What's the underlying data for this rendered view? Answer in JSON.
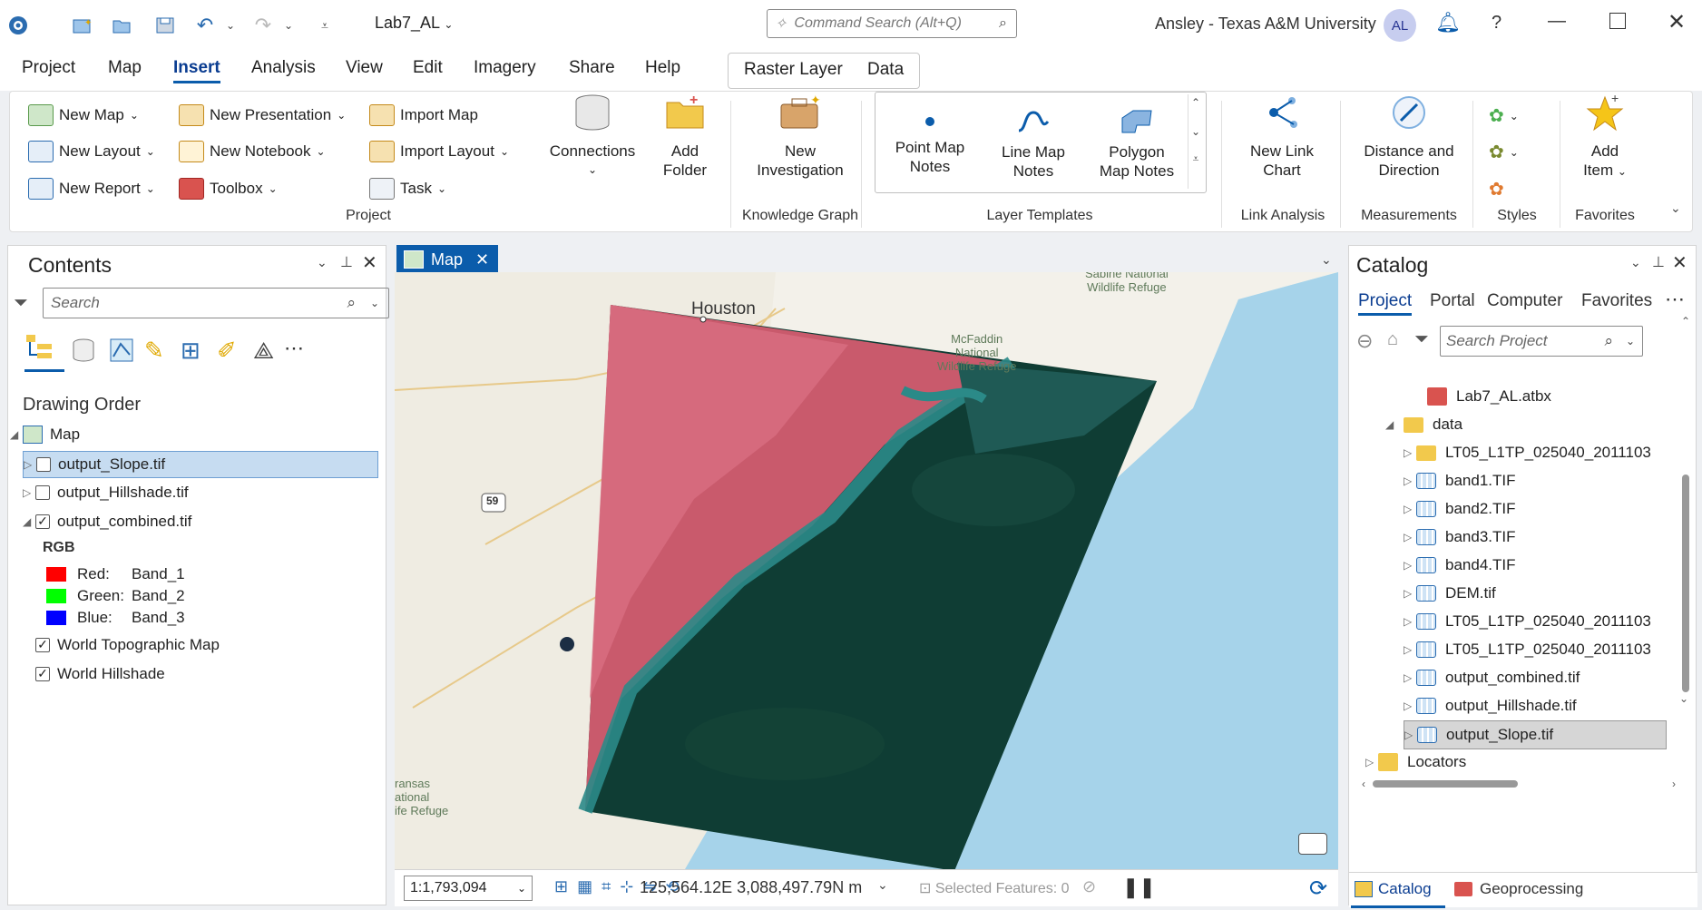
{
  "titlebar": {
    "project_name": "Lab7_AL",
    "command_search_placeholder": "Command Search (Alt+Q)",
    "user": "Ansley - Texas A&M University",
    "avatar_initials": "AL",
    "help": "?"
  },
  "menu": {
    "tabs": [
      "Project",
      "Map",
      "Insert",
      "Analysis",
      "View",
      "Edit",
      "Imagery",
      "Share",
      "Help"
    ],
    "active": "Insert",
    "contextual_tabs": [
      "Raster Layer",
      "Data"
    ]
  },
  "ribbon": {
    "project_group": {
      "label": "Project",
      "new_map": "New Map",
      "new_layout": "New Layout",
      "new_report": "New Report",
      "new_presentation": "New Presentation",
      "new_notebook": "New Notebook",
      "toolbox": "Toolbox",
      "import_map": "Import Map",
      "import_layout": "Import Layout",
      "task": "Task",
      "connections": "Connections",
      "add_folder_1": "Add",
      "add_folder_2": "Folder"
    },
    "knowledge_graph": {
      "label": "Knowledge Graph",
      "line1": "New",
      "line2": "Investigation"
    },
    "layer_templates": {
      "label": "Layer Templates",
      "point_1": "Point Map",
      "point_2": "Notes",
      "line_1": "Line Map",
      "line_2": "Notes",
      "polygon_1": "Polygon",
      "polygon_2": "Map Notes"
    },
    "link_analysis": {
      "label": "Link Analysis",
      "line1": "New Link",
      "line2": "Chart"
    },
    "measurements": {
      "label": "Measurements",
      "line1": "Distance and",
      "line2": "Direction"
    },
    "styles": {
      "label": "Styles"
    },
    "favorites": {
      "label": "Favorites",
      "line1": "Add",
      "line2": "Item"
    }
  },
  "contents": {
    "title": "Contents",
    "search_placeholder": "Search",
    "section": "Drawing Order",
    "map_label": "Map",
    "layers": [
      {
        "name": "output_Slope.tif",
        "checked": false,
        "selected": true
      },
      {
        "name": "output_Hillshade.tif",
        "checked": false
      },
      {
        "name": "output_combined.tif",
        "checked": true
      }
    ],
    "rgb_label": "RGB",
    "bands": [
      {
        "label": "Red:",
        "band": "Band_1",
        "color": "#ff0000"
      },
      {
        "label": "Green:",
        "band": "Band_2",
        "color": "#00ff00"
      },
      {
        "label": "Blue:",
        "band": "Band_3",
        "color": "#0000ff"
      }
    ],
    "basemaps": [
      "World Topographic Map",
      "World Hillshade"
    ]
  },
  "map": {
    "tab_label": "Map",
    "labels": {
      "houston": "Houston",
      "sabine_1": "Sabine National",
      "sabine_2": "Wildlife Refuge",
      "mcfaddin_1": "McFaddin",
      "mcfaddin_2": "National",
      "mcfaddin_3": "Wildlife Refuge",
      "aransas_1": "ransas",
      "aransas_2": "ational",
      "aransas_3": "ife Refuge",
      "highway": "59"
    },
    "scale": "1:1,793,094",
    "coordinates": "125,564.12E 3,088,497.79N m",
    "selected_features": "Selected Features: 0"
  },
  "catalog": {
    "title": "Catalog",
    "tabs": [
      "Project",
      "Portal",
      "Computer",
      "Favorites"
    ],
    "active_tab": "Project",
    "search_placeholder": "Search Project",
    "items": [
      {
        "name": "Lab7_AL.atbx",
        "type": "toolbox",
        "level": 2
      },
      {
        "name": "data",
        "type": "folder",
        "level": 1,
        "expanded": true
      },
      {
        "name": "LT05_L1TP_025040_2011103",
        "type": "folder",
        "level": 2
      },
      {
        "name": "band1.TIF",
        "type": "raster",
        "level": 2
      },
      {
        "name": "band2.TIF",
        "type": "raster",
        "level": 2
      },
      {
        "name": "band3.TIF",
        "type": "raster",
        "level": 2
      },
      {
        "name": "band4.TIF",
        "type": "raster",
        "level": 2
      },
      {
        "name": "DEM.tif",
        "type": "raster",
        "level": 2
      },
      {
        "name": "LT05_L1TP_025040_2011103",
        "type": "raster",
        "level": 2
      },
      {
        "name": "LT05_L1TP_025040_2011103",
        "type": "raster",
        "level": 2
      },
      {
        "name": "output_combined.tif",
        "type": "raster",
        "level": 2
      },
      {
        "name": "output_Hillshade.tif",
        "type": "raster",
        "level": 2
      },
      {
        "name": "output_Slope.tif",
        "type": "raster",
        "level": 2,
        "selected": true
      },
      {
        "name": "Locators",
        "type": "locator",
        "level": 0
      }
    ],
    "bottom_tabs": [
      "Catalog",
      "Geoprocessing"
    ]
  }
}
